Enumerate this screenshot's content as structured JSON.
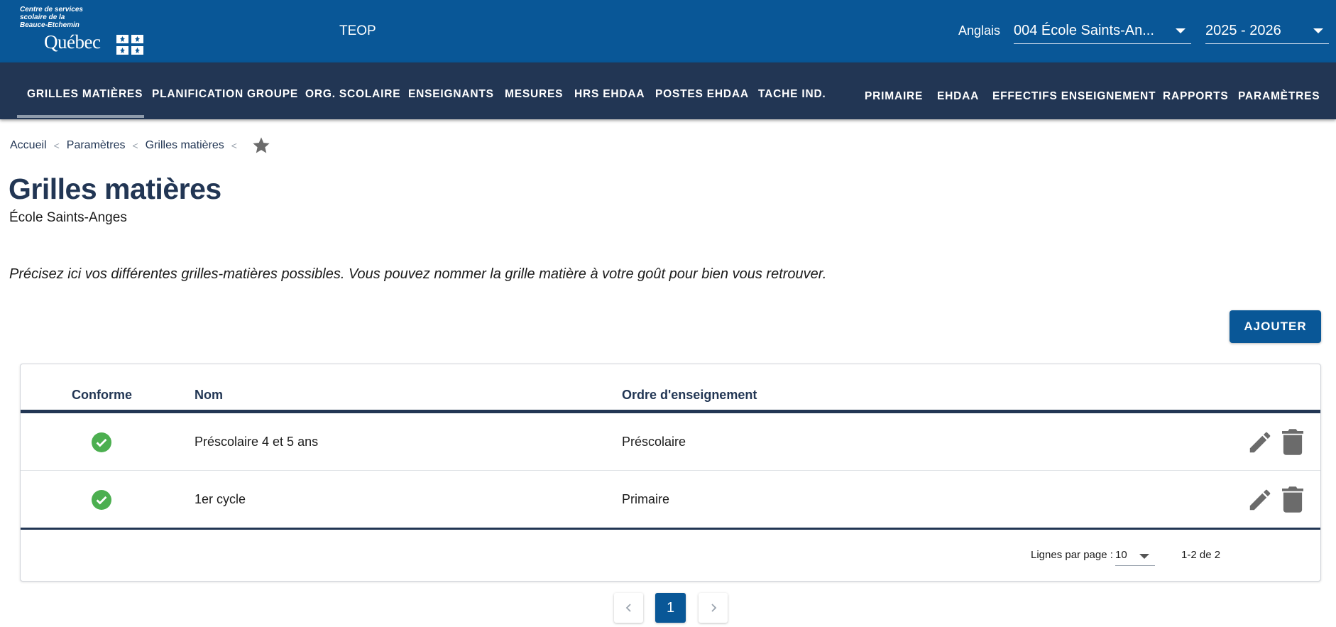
{
  "header": {
    "org_name": "Centre de services\nscolaire de la\nBeauce-Etchemin",
    "logo_text": "Québec",
    "app_title": "TEOP",
    "language_link": "Anglais",
    "school_select": "004 École Saints-An...",
    "year_select": "2025 - 2026",
    "brand_color": "#095797"
  },
  "nav": {
    "left": [
      "GRILLES MATIÈRES",
      "PLANIFICATION GROUPE",
      "ORG. SCOLAIRE",
      "ENSEIGNANTS",
      "MESURES",
      "HRS EHDAA",
      "POSTES EHDAA",
      "TACHE IND."
    ],
    "right": [
      "PRIMAIRE",
      "EHDAA",
      "EFFECTIFS ENSEIGNEMENT",
      "RAPPORTS",
      "PARAMÈTRES"
    ],
    "active": "GRILLES MATIÈRES",
    "bar_color": "#223654"
  },
  "breadcrumb": [
    "Accueil",
    "Paramètres",
    "Grilles matières"
  ],
  "page": {
    "title": "Grilles matières",
    "subtitle": "École Saints-Anges",
    "intro": "Précisez ici vos différentes grilles-matières possibles. Vous pouvez nommer la grille matière à votre goût pour bien vous retrouver.",
    "add_button": "AJOUTER"
  },
  "table": {
    "columns": [
      "Conforme",
      "Nom",
      "Ordre d'enseignement"
    ],
    "rows": [
      {
        "conforme": "check-circle-icon",
        "nom": "Préscolaire 4 et 5 ans",
        "ordre": "Préscolaire"
      },
      {
        "conforme": "check-circle-icon",
        "nom": "1er cycle",
        "ordre": "Primaire"
      }
    ],
    "rows_per_page_label": "Lignes par page :",
    "rows_per_page": "10",
    "range": "1-2 de 2",
    "ok_color": "#4caf50"
  },
  "pagination": {
    "current": "1"
  }
}
